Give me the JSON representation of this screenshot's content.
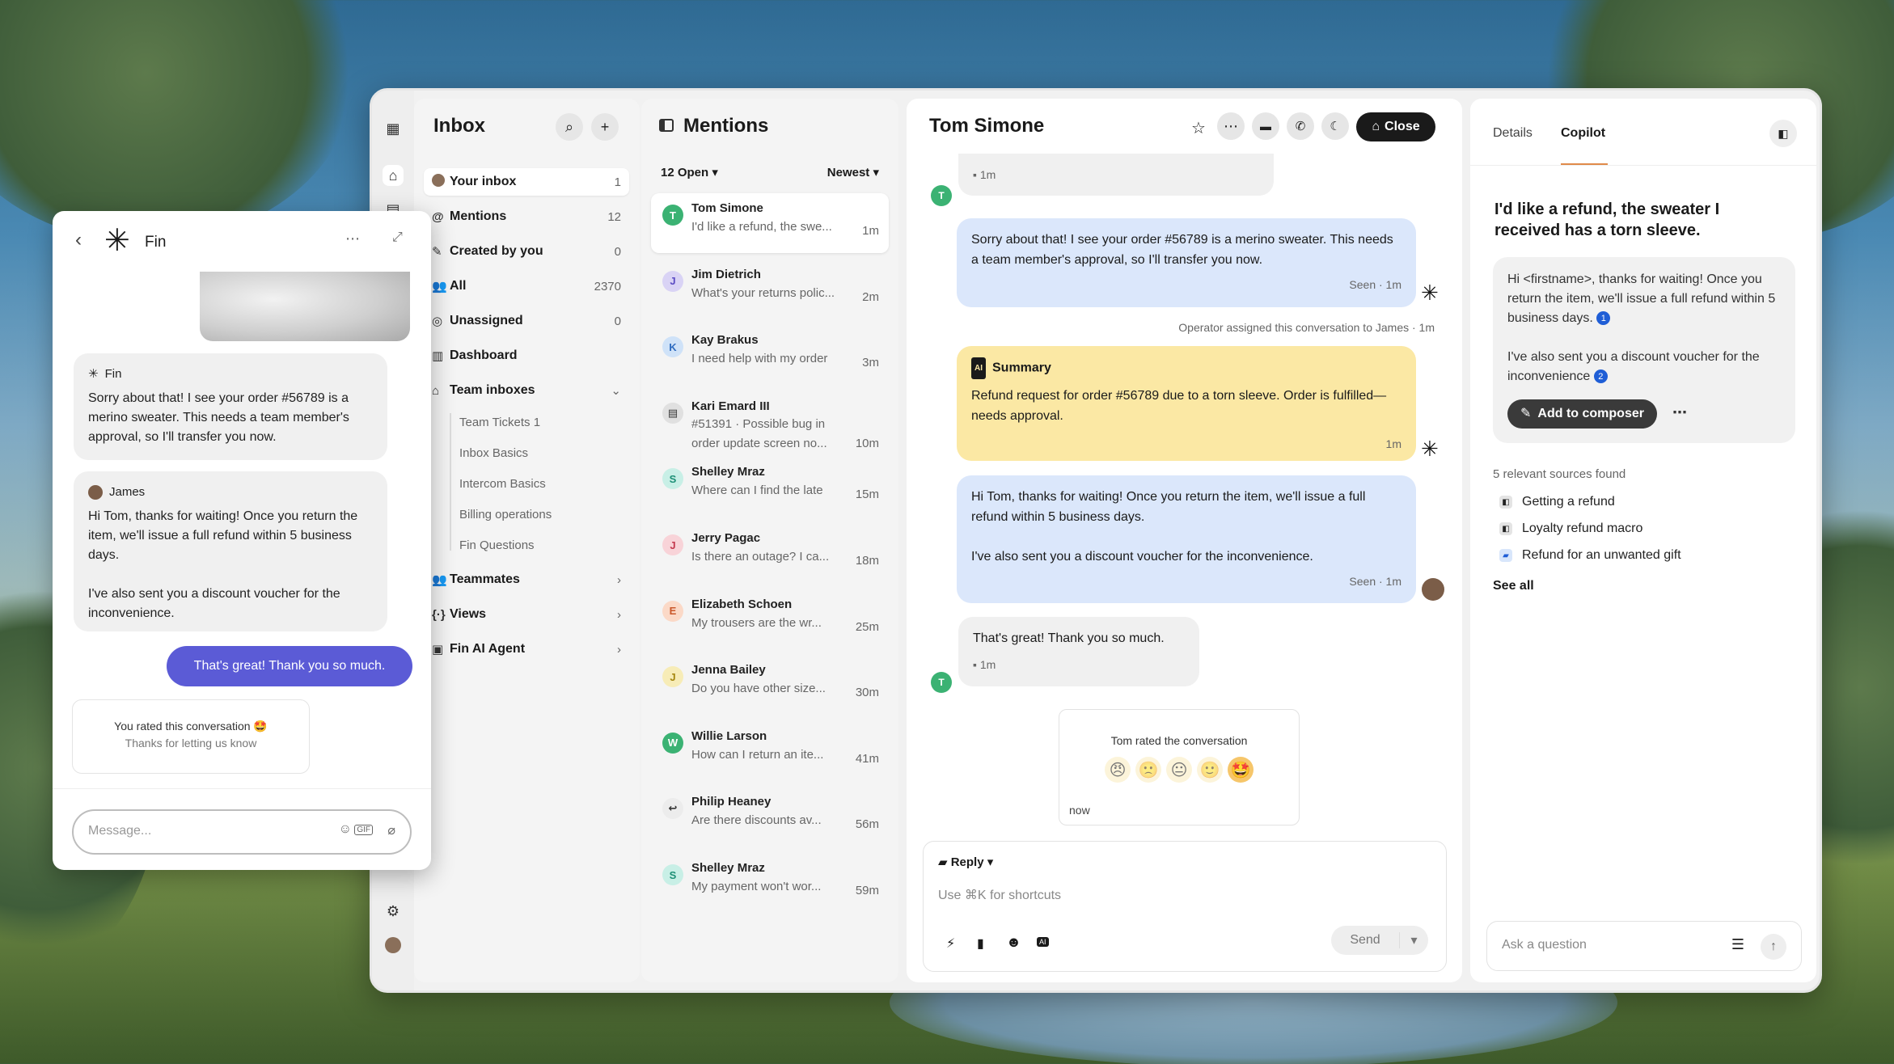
{
  "app": {
    "nav_title": "Inbox",
    "mentions_title": "Mentions",
    "conv_title": "Tom Simone",
    "close_label": "Close"
  },
  "nav": {
    "items": [
      {
        "label": "Your inbox",
        "count": "1",
        "icon": "avatar"
      },
      {
        "label": "Mentions",
        "count": "12",
        "icon": "@"
      },
      {
        "label": "Created by you",
        "count": "0",
        "icon": "✎"
      },
      {
        "label": "All",
        "count": "2370",
        "icon": "👥"
      },
      {
        "label": "Unassigned",
        "count": "0",
        "icon": "◎"
      },
      {
        "label": "Dashboard",
        "count": "",
        "icon": "▥"
      },
      {
        "label": "Team inboxes",
        "count": "",
        "icon": "⌂"
      }
    ],
    "subitems": [
      "Team Tickets 1",
      "Inbox Basics",
      "Intercom Basics",
      "Billing operations",
      "Fin Questions"
    ],
    "groups": [
      "Teammates",
      "Views",
      "Fin AI Agent"
    ]
  },
  "mentions": {
    "filter_open": "12 Open",
    "filter_sort": "Newest",
    "rows": [
      {
        "initial": "T",
        "name": "Tom Simone",
        "preview": "I'd like a refund, the swe...",
        "time": "1m",
        "bg": "#3bb273",
        "fg": "#ffffff"
      },
      {
        "initial": "J",
        "name": "Jim Dietrich",
        "preview": "What's your returns polic...",
        "time": "2m",
        "bg": "#d9d3f5",
        "fg": "#5b4cc4"
      },
      {
        "initial": "K",
        "name": "Kay Brakus",
        "preview": "I need help with my order",
        "time": "3m",
        "bg": "#cfe2f8",
        "fg": "#2f6cc0"
      },
      {
        "initial": "▤",
        "name": "Kari Emard III",
        "preview": "#51391 · Possible bug in order update screen no...",
        "time": "10m",
        "bg": "#e0e0e0",
        "fg": "#333333"
      },
      {
        "initial": "S",
        "name": "Shelley Mraz",
        "preview": "Where can I find the late",
        "time": "15m",
        "bg": "#c8efe6",
        "fg": "#1d8f76"
      },
      {
        "initial": "J",
        "name": "Jerry Pagac",
        "preview": "Is there an outage? I ca...",
        "time": "18m",
        "bg": "#f8d3d8",
        "fg": "#c43a4f"
      },
      {
        "initial": "E",
        "name": "Elizabeth Schoen",
        "preview": "My trousers are the wr...",
        "time": "25m",
        "bg": "#fbd9c7",
        "fg": "#c9572a"
      },
      {
        "initial": "J",
        "name": "Jenna Bailey",
        "preview": "Do you have other size...",
        "time": "30m",
        "bg": "#f7ecb7",
        "fg": "#a5860f"
      },
      {
        "initial": "W",
        "name": "Willie Larson",
        "preview": "How can I return an ite...",
        "time": "41m",
        "bg": "#3bb273",
        "fg": "#ffffff"
      },
      {
        "initial": "↩",
        "name": "Philip Heaney",
        "preview": "Are there discounts av...",
        "time": "56m",
        "bg": "#ececec",
        "fg": "#333333"
      },
      {
        "initial": "S",
        "name": "Shelley Mraz",
        "preview": "My payment won't wor...",
        "time": "59m",
        "bg": "#c8efe6",
        "fg": "#1d8f76"
      }
    ]
  },
  "conversation": {
    "top_meta": "1m",
    "msg1": "Sorry about that! I see your order #56789 is a merino sweater. This needs a team member's approval, so I'll transfer you now.",
    "msg1_meta": "Seen · 1m",
    "assign_note": "Operator assigned this conversation to James · 1m",
    "summary_title": "Summary",
    "summary_text": "Refund request for order #56789 due to a torn sleeve. Order is fulfilled—needs approval.",
    "summary_meta": "1m",
    "msg2a": "Hi Tom, thanks for waiting! Once you return the item, we'll issue a full refund within 5 business days.",
    "msg2b": "I've also sent you a discount voucher for the inconvenience.",
    "msg2_meta": "Seen · 1m",
    "msg3": "That's great! Thank you so much.",
    "msg3_meta": "1m",
    "rating_title": "Tom rated the conversation",
    "rating_faces": [
      "😠",
      "🙁",
      "😐",
      "🙂",
      "🤩"
    ],
    "rating_time": "now",
    "reply_mode": "Reply",
    "composer_placeholder": "Use ⌘K for shortcuts",
    "send_label": "Send"
  },
  "copilot": {
    "tab_details": "Details",
    "tab_copilot": "Copilot",
    "question": "I'd like a refund, the sweater I received has a torn sleeve.",
    "answer_p1": "Hi <firstname>, thanks for waiting! Once you return the item, we'll issue a full refund within 5 business days.",
    "answer_p2": "I've also sent you a discount voucher for the inconvenience",
    "badge1": "1",
    "badge2": "2",
    "add_label": "Add to composer",
    "sources_title": "5 relevant sources found",
    "sources": [
      "Getting a refund",
      "Loyalty refund macro",
      "Refund for an unwanted gift"
    ],
    "see_all": "See all",
    "ask_placeholder": "Ask a question"
  },
  "fin": {
    "title": "Fin",
    "bot_name": "Fin",
    "bot_msg": "Sorry about that! I see your order #56789 is a merino sweater. This needs a team member's approval, so I'll transfer you now.",
    "agent_name": "James",
    "agent_msg_a": "Hi Tom, thanks for waiting! Once you return the item, we'll issue a full refund within 5 business days.",
    "agent_msg_b": "I've also sent you a discount voucher for the inconvenience.",
    "user_msg": "That's great! Thank you so much.",
    "rated_title": "You rated this conversation 🤩",
    "rated_sub": "Thanks for letting us know",
    "input_placeholder": "Message..."
  },
  "colors": {
    "accent": "#5b5bd6",
    "user_bubble": "#5b5bd6",
    "copilot_tab": "#e08a4a"
  }
}
